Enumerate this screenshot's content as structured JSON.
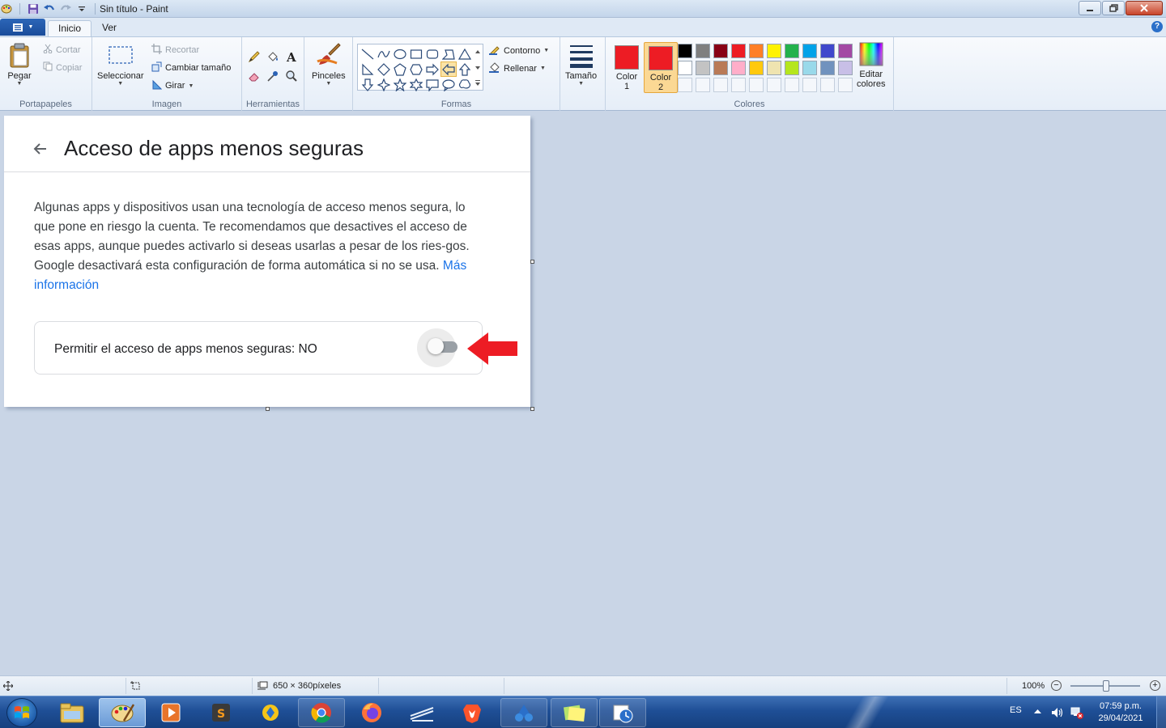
{
  "window": {
    "title": "Sin título - Paint"
  },
  "tabs": {
    "home": "Inicio",
    "view": "Ver"
  },
  "ribbon": {
    "clipboard": {
      "label": "Portapapeles",
      "paste": "Pegar",
      "cut": "Cortar",
      "copy": "Copiar"
    },
    "image": {
      "label": "Imagen",
      "select": "Seleccionar",
      "crop": "Recortar",
      "resize": "Cambiar tamaño",
      "rotate": "Girar"
    },
    "tools": {
      "label": "Herramientas"
    },
    "brushes": {
      "label": "Pinceles"
    },
    "shapes": {
      "label": "Formas",
      "outline": "Contorno",
      "fill": "Rellenar"
    },
    "size": {
      "label": "Tamaño"
    },
    "colors": {
      "label": "Colores",
      "color1_label": "Color",
      "color1_num": "1",
      "color2_label": "Color",
      "color2_num": "2",
      "edit_line1": "Editar",
      "edit_line2": "colores",
      "color1": "#ed1c24",
      "color2": "#ed1c24",
      "palette_row1": [
        "#000000",
        "#7f7f7f",
        "#880015",
        "#ed1c24",
        "#ff7f27",
        "#fff200",
        "#22b14c",
        "#00a2e8",
        "#3f48cc",
        "#a349a4"
      ],
      "palette_row2": [
        "#ffffff",
        "#c3c3c3",
        "#b97a57",
        "#ffaec9",
        "#ffc90e",
        "#efe4b0",
        "#b5e61d",
        "#99d9ea",
        "#7092be",
        "#c8bfe7"
      ]
    }
  },
  "canvas_content": {
    "title": "Acceso de apps menos seguras",
    "body": "Algunas apps y dispositivos usan una tecnología de acceso menos segura, lo que pone en riesgo la cuenta. Te recomendamos que desactives el acceso de esas apps, aunque puedes activarlo si deseas usarlas a pesar de los ries-gos. Google desactivará esta configuración de forma automática si no se usa.",
    "link": "Más información",
    "toggle_label": "Permitir el acceso de apps menos seguras: NO",
    "toggle_on": false
  },
  "statusbar": {
    "dimensions": "650 × 360píxeles",
    "zoom": "100%"
  },
  "taskbar": {
    "lang": "ES",
    "time": "07:59 p.m.",
    "date": "29/04/2021"
  }
}
